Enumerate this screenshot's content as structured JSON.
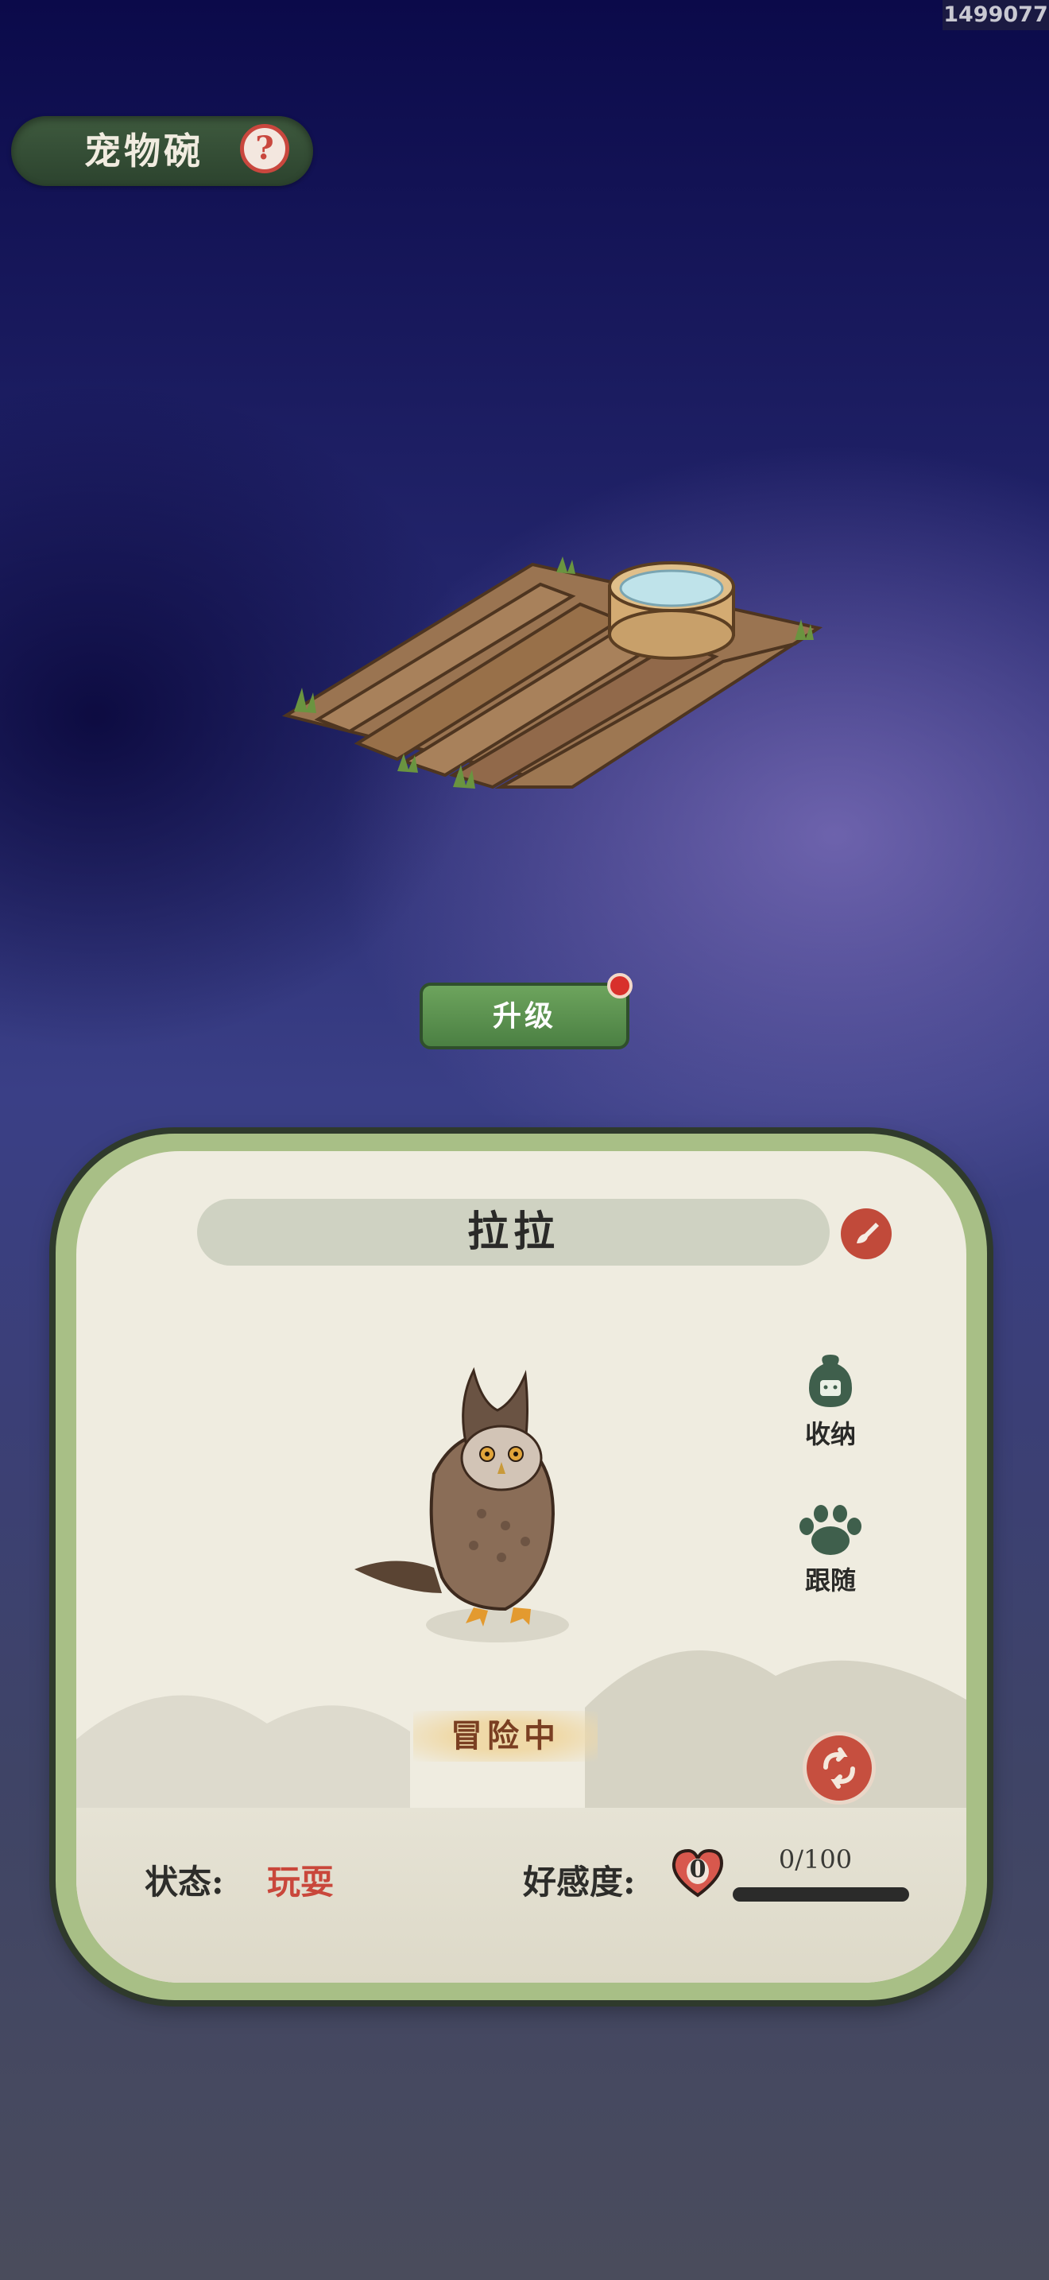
{
  "watermark": "1499077",
  "header": {
    "title": "宠物碗",
    "help_icon": "question-icon"
  },
  "actions": {
    "upgrade_label": "升级"
  },
  "pet": {
    "name": "拉拉",
    "adventure_status": "冒险中",
    "status_label": "状态:",
    "status_value": "玩耍",
    "favor_label": "好感度:",
    "favor_level": "0",
    "favor_progress": "0/100",
    "favor_fraction": 0
  },
  "side_actions": [
    {
      "label": "收纳",
      "icon": "storage-bag-icon"
    },
    {
      "label": "跟随",
      "icon": "paw-icon"
    }
  ],
  "colors": {
    "accent_red": "#c9473b",
    "button_green": "#5a9150",
    "card_border": "#a8bf86"
  }
}
